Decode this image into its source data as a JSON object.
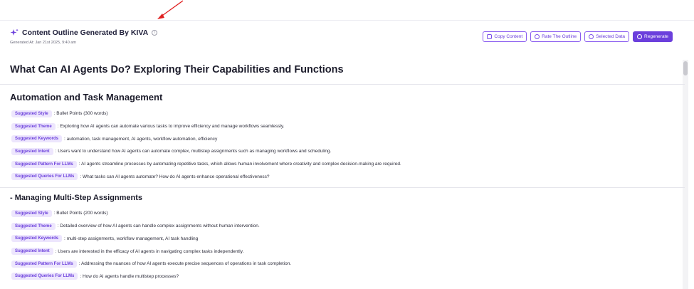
{
  "header": {
    "title": "Content Outline Generated By KIVA",
    "info": "i",
    "generated_at": "Generated At: Jan 21st 2025, 9:40 am"
  },
  "toolbar": {
    "copy_label": "Copy Content",
    "rate_label": "Rate The Outline",
    "selected_label": "Selected Data",
    "regenerate_label": "Regenerate"
  },
  "colors": {
    "accent": "#6b3fdc",
    "pill_bg": "#ede6fd",
    "annotation": "#e02020"
  },
  "page_title": "What Can AI Agents Do? Exploring Their Capabilities and Functions",
  "sections": [
    {
      "title": "Automation and Task Management",
      "rows": [
        {
          "label": "Suggested Style",
          "value": ": Bullet Points (300 words)"
        },
        {
          "label": "Suggested Theme",
          "value": ": Exploring how AI agents can automate various tasks to improve efficiency and manage workflows seamlessly."
        },
        {
          "label": "Suggested Keywords",
          "value": ": automation, task management, AI agents, workflow automation, efficiency"
        },
        {
          "label": "Suggested Intent",
          "value": ": Users want to understand how AI agents can automate complex, multistep assignments such as managing workflows and scheduling."
        },
        {
          "label": "Suggested Pattern For LLMs",
          "value": ": AI agents streamline processes by automating repetitive tasks, which allows human involvement where creativity and complex decision-making are required."
        },
        {
          "label": "Suggested Queries For LLMs",
          "value": ": What tasks can AI agents automate? How do AI agents enhance operational effectiveness?"
        }
      ]
    },
    {
      "title": "- Managing Multi-Step Assignments",
      "rows": [
        {
          "label": "Suggested Style",
          "value": ": Bullet Points (200 words)"
        },
        {
          "label": "Suggested Theme",
          "value": ": Detailed overview of how AI agents can handle complex assignments without human intervention."
        },
        {
          "label": "Suggested Keywords",
          "value": ": multi-step assignments, workflow management, AI task handling"
        },
        {
          "label": "Suggested Intent",
          "value": ": Users are interested in the efficacy of AI agents in navigating complex tasks independently."
        },
        {
          "label": "Suggested Pattern For LLMs",
          "value": ": Addressing the nuances of how AI agents execute precise sequences of operations in task completion."
        },
        {
          "label": "Suggested Queries For LLMs",
          "value": ": How do AI agents handle multistep processes?"
        }
      ]
    }
  ]
}
